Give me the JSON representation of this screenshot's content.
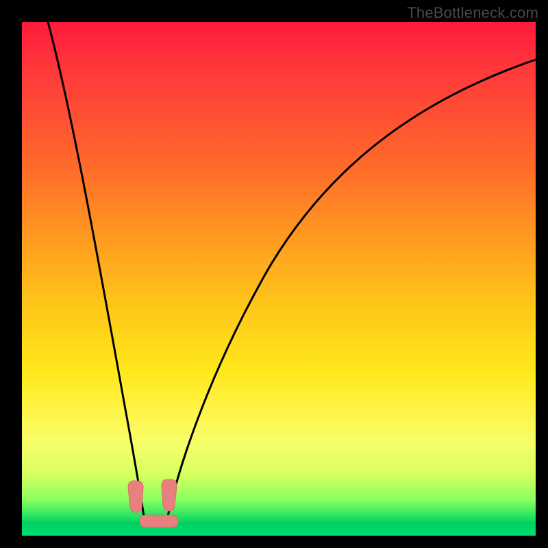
{
  "watermark": "TheBottleneck.com",
  "chart_data": {
    "type": "line",
    "title": "",
    "xlabel": "",
    "ylabel": "",
    "xlim": [
      0,
      100
    ],
    "ylim": [
      0,
      100
    ],
    "grid": false,
    "legend": false,
    "background_gradient": {
      "orientation": "vertical",
      "stops": [
        {
          "pos": 0.0,
          "color": "#ff1a3c"
        },
        {
          "pos": 0.45,
          "color": "#ffb020"
        },
        {
          "pos": 0.75,
          "color": "#fff040"
        },
        {
          "pos": 0.97,
          "color": "#30e060"
        },
        {
          "pos": 1.0,
          "color": "#00e070"
        }
      ]
    },
    "series": [
      {
        "name": "bottleneck-curve",
        "color": "#000000",
        "x": [
          4,
          6,
          8,
          10,
          12,
          14,
          16,
          18,
          20,
          22,
          23,
          24,
          25,
          26,
          27,
          28,
          30,
          33,
          37,
          42,
          48,
          55,
          63,
          72,
          82,
          93,
          100
        ],
        "y": [
          100,
          89,
          78,
          68,
          58,
          49,
          40,
          32,
          24,
          15,
          10,
          5,
          2,
          1,
          2,
          5,
          11,
          19,
          28,
          37,
          46,
          54,
          62,
          69,
          75,
          80,
          83
        ]
      }
    ],
    "markers": [
      {
        "name": "left-lobe",
        "shape": "rounded",
        "x": 22.5,
        "y": 7,
        "color": "#e98080"
      },
      {
        "name": "right-lobe",
        "shape": "rounded",
        "x": 28.5,
        "y": 7,
        "color": "#e98080"
      },
      {
        "name": "bottom-lobe",
        "shape": "rounded",
        "x": 25.5,
        "y": 1.5,
        "color": "#e98080"
      }
    ]
  }
}
